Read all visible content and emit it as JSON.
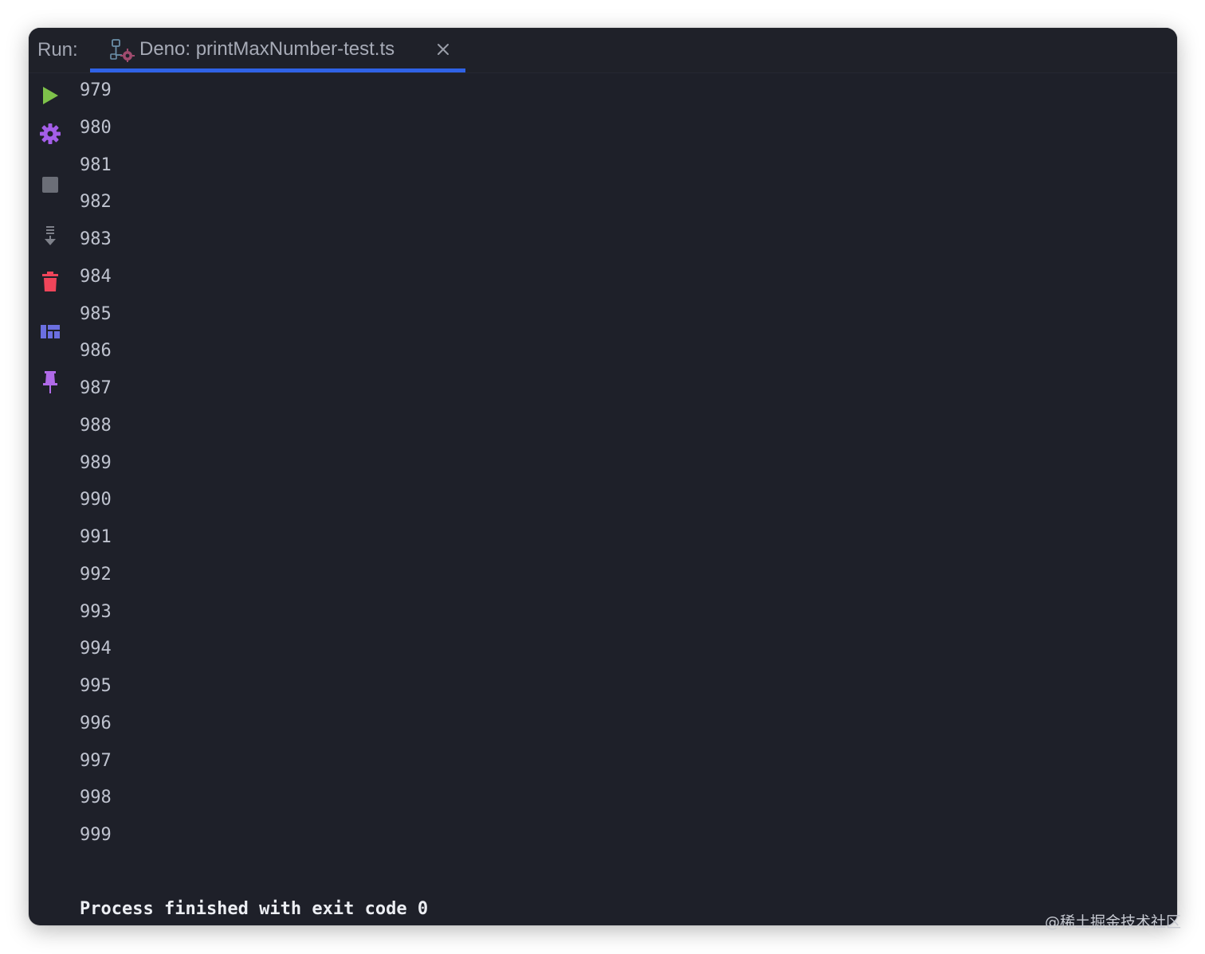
{
  "run_panel": {
    "run_label": "Run:",
    "tab": {
      "label": "Deno: printMaxNumber-test.ts",
      "icon": "deno-run-config-icon",
      "close_icon": "close-icon",
      "underline_color": "#2f62e6"
    }
  },
  "toolbar": {
    "buttons": [
      {
        "name": "rerun-button",
        "icon": "play-icon",
        "color": "#7ec24a"
      },
      {
        "name": "settings-button",
        "icon": "gear-icon",
        "color": "#a45ee8"
      },
      {
        "name": "stop-button",
        "icon": "stop-icon",
        "color": "#6b6e77"
      },
      {
        "name": "scroll-to-end-button",
        "icon": "scroll-to-end-icon",
        "color": "#7e818a"
      },
      {
        "name": "clear-all-button",
        "icon": "trash-icon",
        "color": "#f0455a"
      },
      {
        "name": "restore-layout-button",
        "icon": "layout-icon",
        "color": "#6b6fe0"
      },
      {
        "name": "pin-tab-button",
        "icon": "pin-icon",
        "color": "#b06ae8"
      }
    ]
  },
  "console": {
    "lines": [
      "979",
      "980",
      "981",
      "982",
      "983",
      "984",
      "985",
      "986",
      "987",
      "988",
      "989",
      "990",
      "991",
      "992",
      "993",
      "994",
      "995",
      "996",
      "997",
      "998",
      "999"
    ],
    "finish_message": "Process finished with exit code 0"
  },
  "watermark": "@稀土掘金技术社区"
}
